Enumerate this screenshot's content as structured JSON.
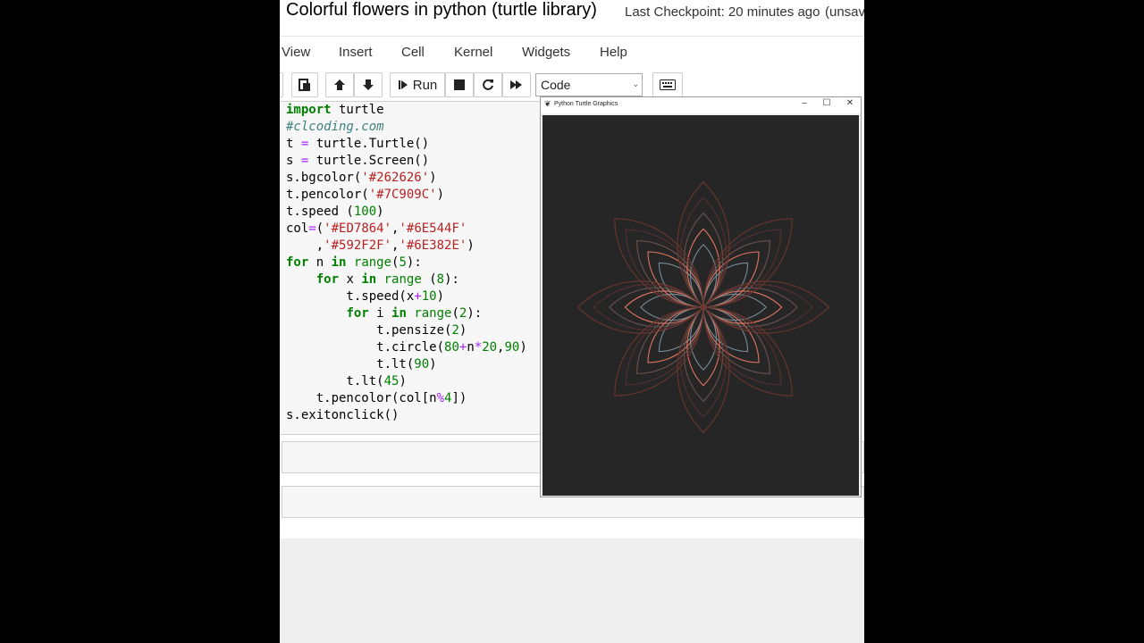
{
  "notebook": {
    "title": "Colorful flowers in python (turtle library)",
    "checkpoint": "Last Checkpoint: 20 minutes ago",
    "unsaved": "(unsaved changes)"
  },
  "menu": [
    "View",
    "Insert",
    "Cell",
    "Kernel",
    "Widgets",
    "Help"
  ],
  "toolbar": {
    "run_label": "Run",
    "cell_type": "Code"
  },
  "code_lines": [
    "import turtle",
    "#clcoding.com",
    "t = turtle.Turtle()",
    "s = turtle.Screen()",
    "s.bgcolor('#262626')",
    "t.pencolor('#7C909C')",
    "t.speed (100)",
    "col=('#ED7864','#6E544F'",
    "    ,'#592F2F','#6E382E')",
    "for n in range(5):",
    "    for x in range (8):",
    "        t.speed(x+10)",
    "        for i in range(2):",
    "            t.pensize(2)",
    "            t.circle(80+n*20,90)",
    "            t.lt(90)",
    "        t.lt(45)",
    "    t.pencolor(col[n%4])",
    "s.exitonclick()"
  ],
  "turtle_window": {
    "title": "Python Turtle Graphics",
    "minimize": "–",
    "maximize": "☐",
    "close": "✕",
    "bgcolor": "#262626"
  },
  "drawing": {
    "base_radius": 80,
    "radius_step": 20,
    "rings": 5,
    "petals": 8,
    "colors": [
      "#7C909C",
      "#ED7864",
      "#6E544F",
      "#592F2F",
      "#6E382E"
    ]
  },
  "icons": {
    "save": "floppy-icon",
    "paste": "paste-icon",
    "up": "arrow-up-icon",
    "down": "arrow-down-icon",
    "run": "run-icon",
    "stop": "stop-icon",
    "restart": "restart-icon",
    "fast_forward": "fast-forward-icon",
    "keyboard": "keyboard-icon"
  }
}
